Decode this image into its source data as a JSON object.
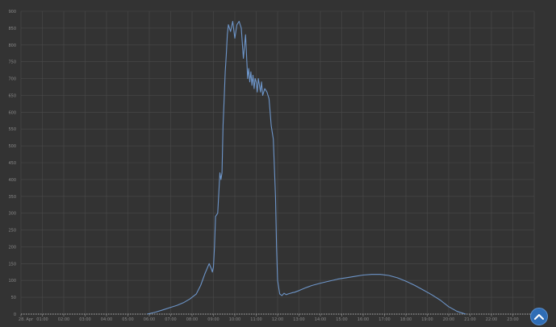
{
  "chart_data": {
    "type": "line",
    "x_unit": "hours",
    "xlim": [
      0,
      24
    ],
    "ylim": [
      0,
      900
    ],
    "grid": true,
    "y_ticks": [
      0,
      50,
      100,
      150,
      200,
      250,
      300,
      350,
      400,
      450,
      500,
      550,
      600,
      650,
      700,
      750,
      800,
      850,
      900
    ],
    "x_ticks": [
      {
        "x": 0,
        "label": "28. Apr"
      },
      {
        "x": 1,
        "label": "01:00"
      },
      {
        "x": 2,
        "label": "02:00"
      },
      {
        "x": 3,
        "label": "03:00"
      },
      {
        "x": 4,
        "label": "04:00"
      },
      {
        "x": 5,
        "label": "05:00"
      },
      {
        "x": 6,
        "label": "06:00"
      },
      {
        "x": 7,
        "label": "07:00"
      },
      {
        "x": 8,
        "label": "08:00"
      },
      {
        "x": 9,
        "label": "09:00"
      },
      {
        "x": 10,
        "label": "10:00"
      },
      {
        "x": 11,
        "label": "11:00"
      },
      {
        "x": 12,
        "label": "12:00"
      },
      {
        "x": 13,
        "label": "13:00"
      },
      {
        "x": 14,
        "label": "14:00"
      },
      {
        "x": 15,
        "label": "15:00"
      },
      {
        "x": 16,
        "label": "16:00"
      },
      {
        "x": 17,
        "label": "17:00"
      },
      {
        "x": 18,
        "label": "18:00"
      },
      {
        "x": 19,
        "label": "19:00"
      },
      {
        "x": 20,
        "label": "20:00"
      },
      {
        "x": 21,
        "label": "21:00"
      },
      {
        "x": 22,
        "label": "22:00"
      },
      {
        "x": 23,
        "label": "23:00"
      }
    ],
    "series": [
      {
        "color": "#6d95c9",
        "x": [
          5.9,
          6.3,
          6.7,
          7.0,
          7.3,
          7.6,
          7.9,
          8.2,
          8.4,
          8.6,
          8.8,
          8.9,
          8.95,
          9.0,
          9.05,
          9.1,
          9.2,
          9.3,
          9.35,
          9.4,
          9.45,
          9.5,
          9.55,
          9.6,
          9.65,
          9.7,
          9.8,
          9.9,
          10.0,
          10.1,
          10.2,
          10.3,
          10.4,
          10.5,
          10.6,
          10.65,
          10.7,
          10.75,
          10.8,
          10.85,
          10.9,
          10.95,
          11.0,
          11.05,
          11.1,
          11.15,
          11.2,
          11.25,
          11.3,
          11.4,
          11.5,
          11.6,
          11.7,
          11.8,
          11.9,
          11.95,
          12.0,
          12.1,
          12.2,
          12.3,
          12.4,
          12.5,
          12.6,
          12.7,
          12.8,
          13.0,
          13.3,
          13.6,
          14.0,
          14.4,
          14.8,
          15.2,
          15.6,
          16.0,
          16.4,
          16.8,
          17.2,
          17.6,
          18.0,
          18.4,
          18.8,
          19.2,
          19.6,
          20.0,
          20.4,
          20.8
        ],
        "y": [
          0,
          6,
          14,
          20,
          26,
          34,
          45,
          60,
          85,
          120,
          150,
          135,
          125,
          140,
          200,
          290,
          300,
          420,
          400,
          420,
          560,
          640,
          720,
          770,
          830,
          860,
          840,
          870,
          820,
          860,
          870,
          850,
          760,
          830,
          700,
          730,
          690,
          720,
          680,
          710,
          670,
          700,
          690,
          660,
          700,
          680,
          660,
          690,
          650,
          670,
          660,
          640,
          560,
          520,
          350,
          200,
          100,
          60,
          55,
          62,
          58,
          60,
          62,
          64,
          65,
          70,
          78,
          85,
          92,
          98,
          104,
          108,
          112,
          116,
          118,
          118,
          115,
          108,
          98,
          86,
          72,
          58,
          42,
          22,
          8,
          0
        ]
      }
    ]
  }
}
